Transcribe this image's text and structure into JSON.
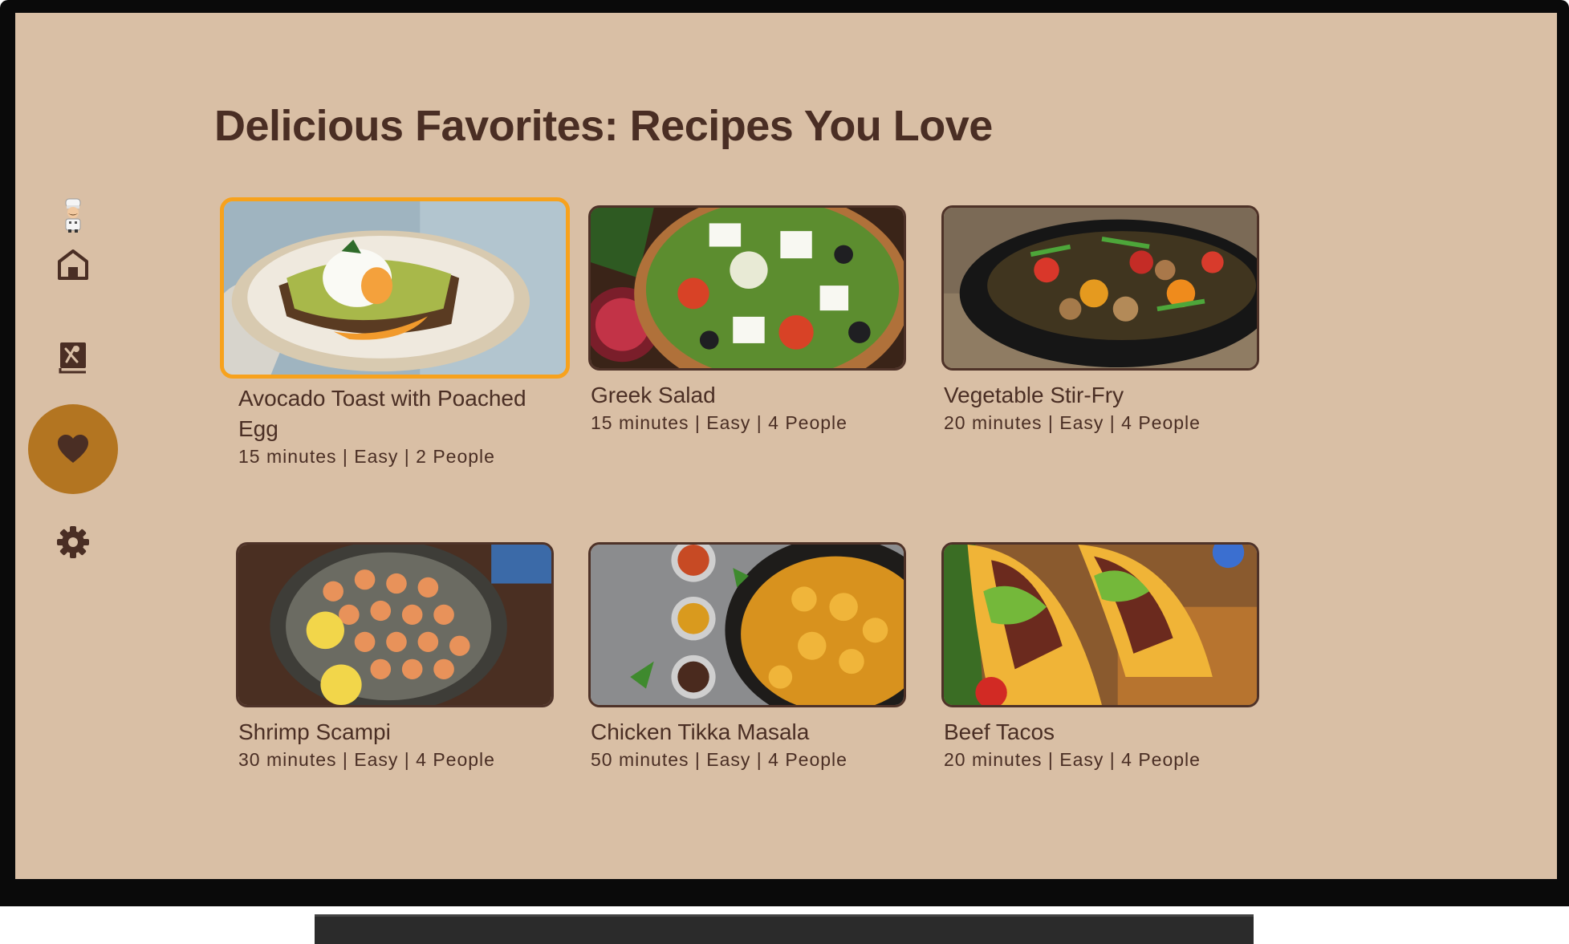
{
  "page": {
    "title": "Delicious Favorites: Recipes You Love"
  },
  "nav": {
    "items": [
      {
        "icon": "chef-avatar-icon",
        "label": "Profile"
      },
      {
        "icon": "home-icon",
        "label": "Home"
      },
      {
        "icon": "recipe-book-icon",
        "label": "Recipes"
      },
      {
        "icon": "heart-icon",
        "label": "Favorites",
        "selected": true
      },
      {
        "icon": "gear-icon",
        "label": "Settings"
      }
    ],
    "active_color": "#b37521"
  },
  "recipes": [
    {
      "title": "Avocado Toast with Poached Egg",
      "meta": "15 minutes | Easy | 2 People",
      "focused": true
    },
    {
      "title": "Greek Salad",
      "meta": "15 minutes | Easy | 4 People"
    },
    {
      "title": "Vegetable Stir-Fry",
      "meta": "20 minutes | Easy | 4 People"
    },
    {
      "title": "Shrimp Scampi",
      "meta": "30 minutes | Easy | 4 People"
    },
    {
      "title": "Chicken Tikka Masala",
      "meta": "50 minutes | Easy | 4 People"
    },
    {
      "title": "Beef Tacos",
      "meta": "20 minutes | Easy | 4 People"
    }
  ],
  "colors": {
    "background": "#d9bfa5",
    "text": "#4a2e24",
    "focus_border": "#f7a21d"
  }
}
